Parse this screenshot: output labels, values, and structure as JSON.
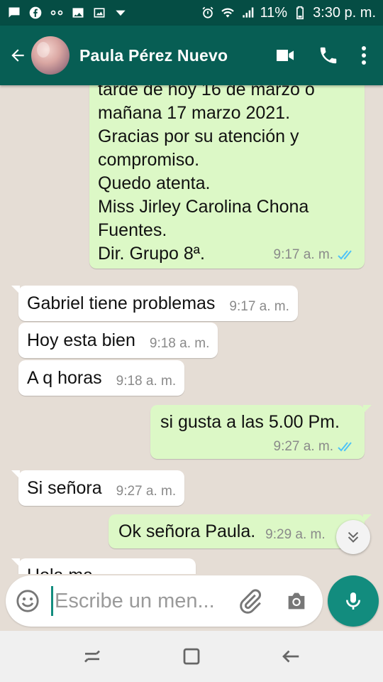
{
  "status_bar": {
    "battery": "11%",
    "time": "3:30 p. m."
  },
  "header": {
    "contact_name": "Paula Pérez Nuevo"
  },
  "messages": {
    "long_message": {
      "lines": [
        "tarde de hoy 16 de marzo o",
        "mañana 17 marzo 2021.",
        "Gracias por su atención y",
        "compromiso.",
        "Quedo atenta.",
        "Miss Jirley Carolina Chona",
        "Fuentes.",
        "Dir. Grupo 8ª."
      ],
      "time": "9:17 a. m."
    },
    "m1": {
      "text": "Gabriel tiene problemas",
      "time": "9:17 a. m."
    },
    "m2": {
      "text": "Hoy esta bien",
      "time": "9:18 a. m."
    },
    "m3": {
      "text": "A q horas",
      "time": "9:18 a. m."
    },
    "m4": {
      "text": "si gusta a las 5.00 Pm.",
      "time": "9:27 a. m."
    },
    "m5": {
      "text": "Si señora",
      "time": "9:27 a. m."
    },
    "m6": {
      "text": "Ok señora Paula.",
      "time": "9:29 a. m."
    },
    "m7": {
      "text": "Hola ma",
      "time": ""
    }
  },
  "composer": {
    "placeholder": "Escribe un men..."
  },
  "colors": {
    "header": "#075e54",
    "status_bar": "#054d44",
    "chat_background": "#e5ddd5",
    "outgoing_bubble": "#dcf8c6",
    "incoming_bubble": "#ffffff",
    "accent": "#128c7e",
    "read_tick": "#4fc3f7"
  },
  "icons": {
    "status_left": [
      "chat-icon",
      "facebook-icon",
      "voicemail-icon",
      "image-icon",
      "gallery-icon",
      "dropdown-icon"
    ],
    "status_right": [
      "alarm-icon",
      "wifi-icon",
      "signal-icon",
      "battery-icon"
    ],
    "header": [
      "back-arrow-icon",
      "video-call-icon",
      "phone-icon",
      "more-vert-icon"
    ],
    "composer": [
      "emoji-icon",
      "attach-icon",
      "camera-icon",
      "mic-icon"
    ],
    "scroll": "chevron-double-down-icon",
    "nav": [
      "recents-icon",
      "home-icon",
      "back-icon"
    ]
  }
}
